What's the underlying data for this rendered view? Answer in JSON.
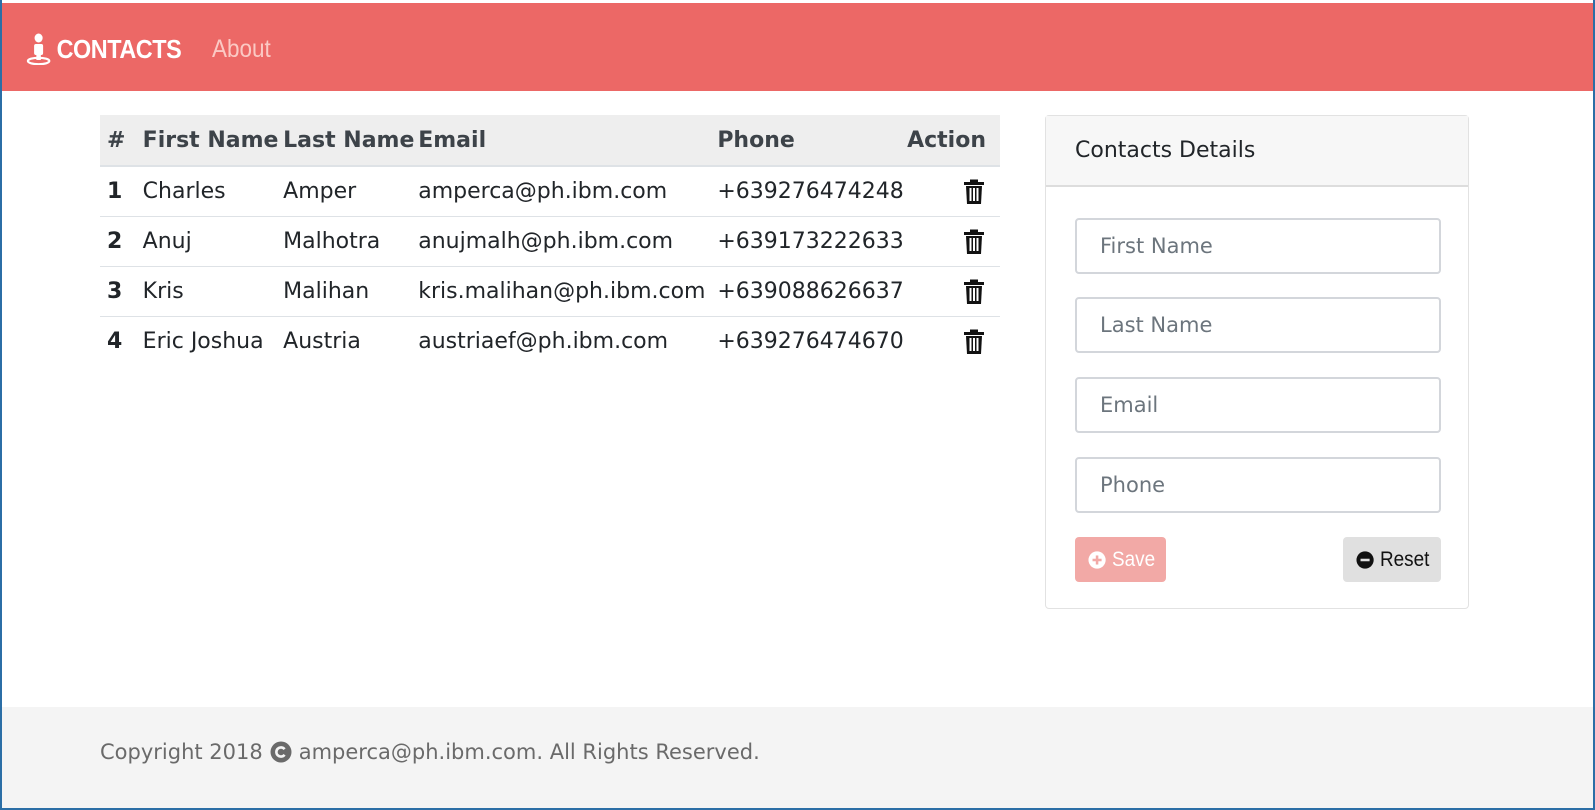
{
  "navbar": {
    "brand_icon": "person-icon",
    "brand_label": "CONTACTS",
    "about_label": "About",
    "bg_color": "#ec6866"
  },
  "table": {
    "headers": {
      "num": "#",
      "first_name": "First Name",
      "last_name": "Last Name",
      "email": "Email",
      "phone": "Phone",
      "action": "Action"
    },
    "rows": [
      {
        "num": "1",
        "first_name": "Charles",
        "last_name": "Amper",
        "email": "amperca@ph.ibm.com",
        "phone": "+639276474248",
        "action_icon": "trash-icon"
      },
      {
        "num": "2",
        "first_name": "Anuj",
        "last_name": "Malhotra",
        "email": "anujmalh@ph.ibm.com",
        "phone": "+639173222633",
        "action_icon": "trash-icon"
      },
      {
        "num": "3",
        "first_name": "Kris",
        "last_name": "Malihan",
        "email": "kris.malihan@ph.ibm.com",
        "phone": "+639088626637",
        "action_icon": "trash-icon"
      },
      {
        "num": "4",
        "first_name": "Eric Joshua",
        "last_name": "Austria",
        "email": "austriaef@ph.ibm.com",
        "phone": "+639276474670",
        "action_icon": "trash-icon"
      }
    ]
  },
  "details": {
    "title": "Contacts Details",
    "fields": {
      "first_name": {
        "placeholder": "First Name",
        "value": ""
      },
      "last_name": {
        "placeholder": "Last Name",
        "value": ""
      },
      "email": {
        "placeholder": "Email",
        "value": ""
      },
      "phone": {
        "placeholder": "Phone",
        "value": ""
      }
    },
    "save_label": "Save",
    "save_icon": "plus-circle-icon",
    "save_color": "#f2a9a6",
    "reset_label": "Reset",
    "reset_icon": "minus-circle-icon",
    "reset_color": "#e0e0e0"
  },
  "footer": {
    "prefix": "Copyright 2018",
    "icon": "copyright-icon",
    "suffix": "amperca@ph.ibm.com. All Rights Reserved."
  }
}
